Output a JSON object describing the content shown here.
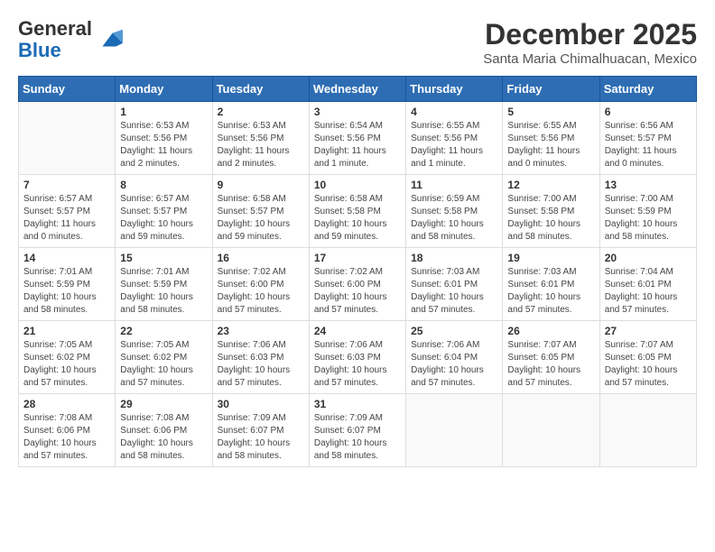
{
  "logo": {
    "general": "General",
    "blue": "Blue"
  },
  "title": "December 2025",
  "location": "Santa Maria Chimalhuacan, Mexico",
  "days_of_week": [
    "Sunday",
    "Monday",
    "Tuesday",
    "Wednesday",
    "Thursday",
    "Friday",
    "Saturday"
  ],
  "weeks": [
    [
      {
        "date": "",
        "info": ""
      },
      {
        "date": "1",
        "info": "Sunrise: 6:53 AM\nSunset: 5:56 PM\nDaylight: 11 hours\nand 2 minutes."
      },
      {
        "date": "2",
        "info": "Sunrise: 6:53 AM\nSunset: 5:56 PM\nDaylight: 11 hours\nand 2 minutes."
      },
      {
        "date": "3",
        "info": "Sunrise: 6:54 AM\nSunset: 5:56 PM\nDaylight: 11 hours\nand 1 minute."
      },
      {
        "date": "4",
        "info": "Sunrise: 6:55 AM\nSunset: 5:56 PM\nDaylight: 11 hours\nand 1 minute."
      },
      {
        "date": "5",
        "info": "Sunrise: 6:55 AM\nSunset: 5:56 PM\nDaylight: 11 hours\nand 0 minutes."
      },
      {
        "date": "6",
        "info": "Sunrise: 6:56 AM\nSunset: 5:57 PM\nDaylight: 11 hours\nand 0 minutes."
      }
    ],
    [
      {
        "date": "7",
        "info": "Sunrise: 6:57 AM\nSunset: 5:57 PM\nDaylight: 11 hours\nand 0 minutes."
      },
      {
        "date": "8",
        "info": "Sunrise: 6:57 AM\nSunset: 5:57 PM\nDaylight: 10 hours\nand 59 minutes."
      },
      {
        "date": "9",
        "info": "Sunrise: 6:58 AM\nSunset: 5:57 PM\nDaylight: 10 hours\nand 59 minutes."
      },
      {
        "date": "10",
        "info": "Sunrise: 6:58 AM\nSunset: 5:58 PM\nDaylight: 10 hours\nand 59 minutes."
      },
      {
        "date": "11",
        "info": "Sunrise: 6:59 AM\nSunset: 5:58 PM\nDaylight: 10 hours\nand 58 minutes."
      },
      {
        "date": "12",
        "info": "Sunrise: 7:00 AM\nSunset: 5:58 PM\nDaylight: 10 hours\nand 58 minutes."
      },
      {
        "date": "13",
        "info": "Sunrise: 7:00 AM\nSunset: 5:59 PM\nDaylight: 10 hours\nand 58 minutes."
      }
    ],
    [
      {
        "date": "14",
        "info": "Sunrise: 7:01 AM\nSunset: 5:59 PM\nDaylight: 10 hours\nand 58 minutes."
      },
      {
        "date": "15",
        "info": "Sunrise: 7:01 AM\nSunset: 5:59 PM\nDaylight: 10 hours\nand 58 minutes."
      },
      {
        "date": "16",
        "info": "Sunrise: 7:02 AM\nSunset: 6:00 PM\nDaylight: 10 hours\nand 57 minutes."
      },
      {
        "date": "17",
        "info": "Sunrise: 7:02 AM\nSunset: 6:00 PM\nDaylight: 10 hours\nand 57 minutes."
      },
      {
        "date": "18",
        "info": "Sunrise: 7:03 AM\nSunset: 6:01 PM\nDaylight: 10 hours\nand 57 minutes."
      },
      {
        "date": "19",
        "info": "Sunrise: 7:03 AM\nSunset: 6:01 PM\nDaylight: 10 hours\nand 57 minutes."
      },
      {
        "date": "20",
        "info": "Sunrise: 7:04 AM\nSunset: 6:01 PM\nDaylight: 10 hours\nand 57 minutes."
      }
    ],
    [
      {
        "date": "21",
        "info": "Sunrise: 7:05 AM\nSunset: 6:02 PM\nDaylight: 10 hours\nand 57 minutes."
      },
      {
        "date": "22",
        "info": "Sunrise: 7:05 AM\nSunset: 6:02 PM\nDaylight: 10 hours\nand 57 minutes."
      },
      {
        "date": "23",
        "info": "Sunrise: 7:06 AM\nSunset: 6:03 PM\nDaylight: 10 hours\nand 57 minutes."
      },
      {
        "date": "24",
        "info": "Sunrise: 7:06 AM\nSunset: 6:03 PM\nDaylight: 10 hours\nand 57 minutes."
      },
      {
        "date": "25",
        "info": "Sunrise: 7:06 AM\nSunset: 6:04 PM\nDaylight: 10 hours\nand 57 minutes."
      },
      {
        "date": "26",
        "info": "Sunrise: 7:07 AM\nSunset: 6:05 PM\nDaylight: 10 hours\nand 57 minutes."
      },
      {
        "date": "27",
        "info": "Sunrise: 7:07 AM\nSunset: 6:05 PM\nDaylight: 10 hours\nand 57 minutes."
      }
    ],
    [
      {
        "date": "28",
        "info": "Sunrise: 7:08 AM\nSunset: 6:06 PM\nDaylight: 10 hours\nand 57 minutes."
      },
      {
        "date": "29",
        "info": "Sunrise: 7:08 AM\nSunset: 6:06 PM\nDaylight: 10 hours\nand 58 minutes."
      },
      {
        "date": "30",
        "info": "Sunrise: 7:09 AM\nSunset: 6:07 PM\nDaylight: 10 hours\nand 58 minutes."
      },
      {
        "date": "31",
        "info": "Sunrise: 7:09 AM\nSunset: 6:07 PM\nDaylight: 10 hours\nand 58 minutes."
      },
      {
        "date": "",
        "info": ""
      },
      {
        "date": "",
        "info": ""
      },
      {
        "date": "",
        "info": ""
      }
    ]
  ]
}
